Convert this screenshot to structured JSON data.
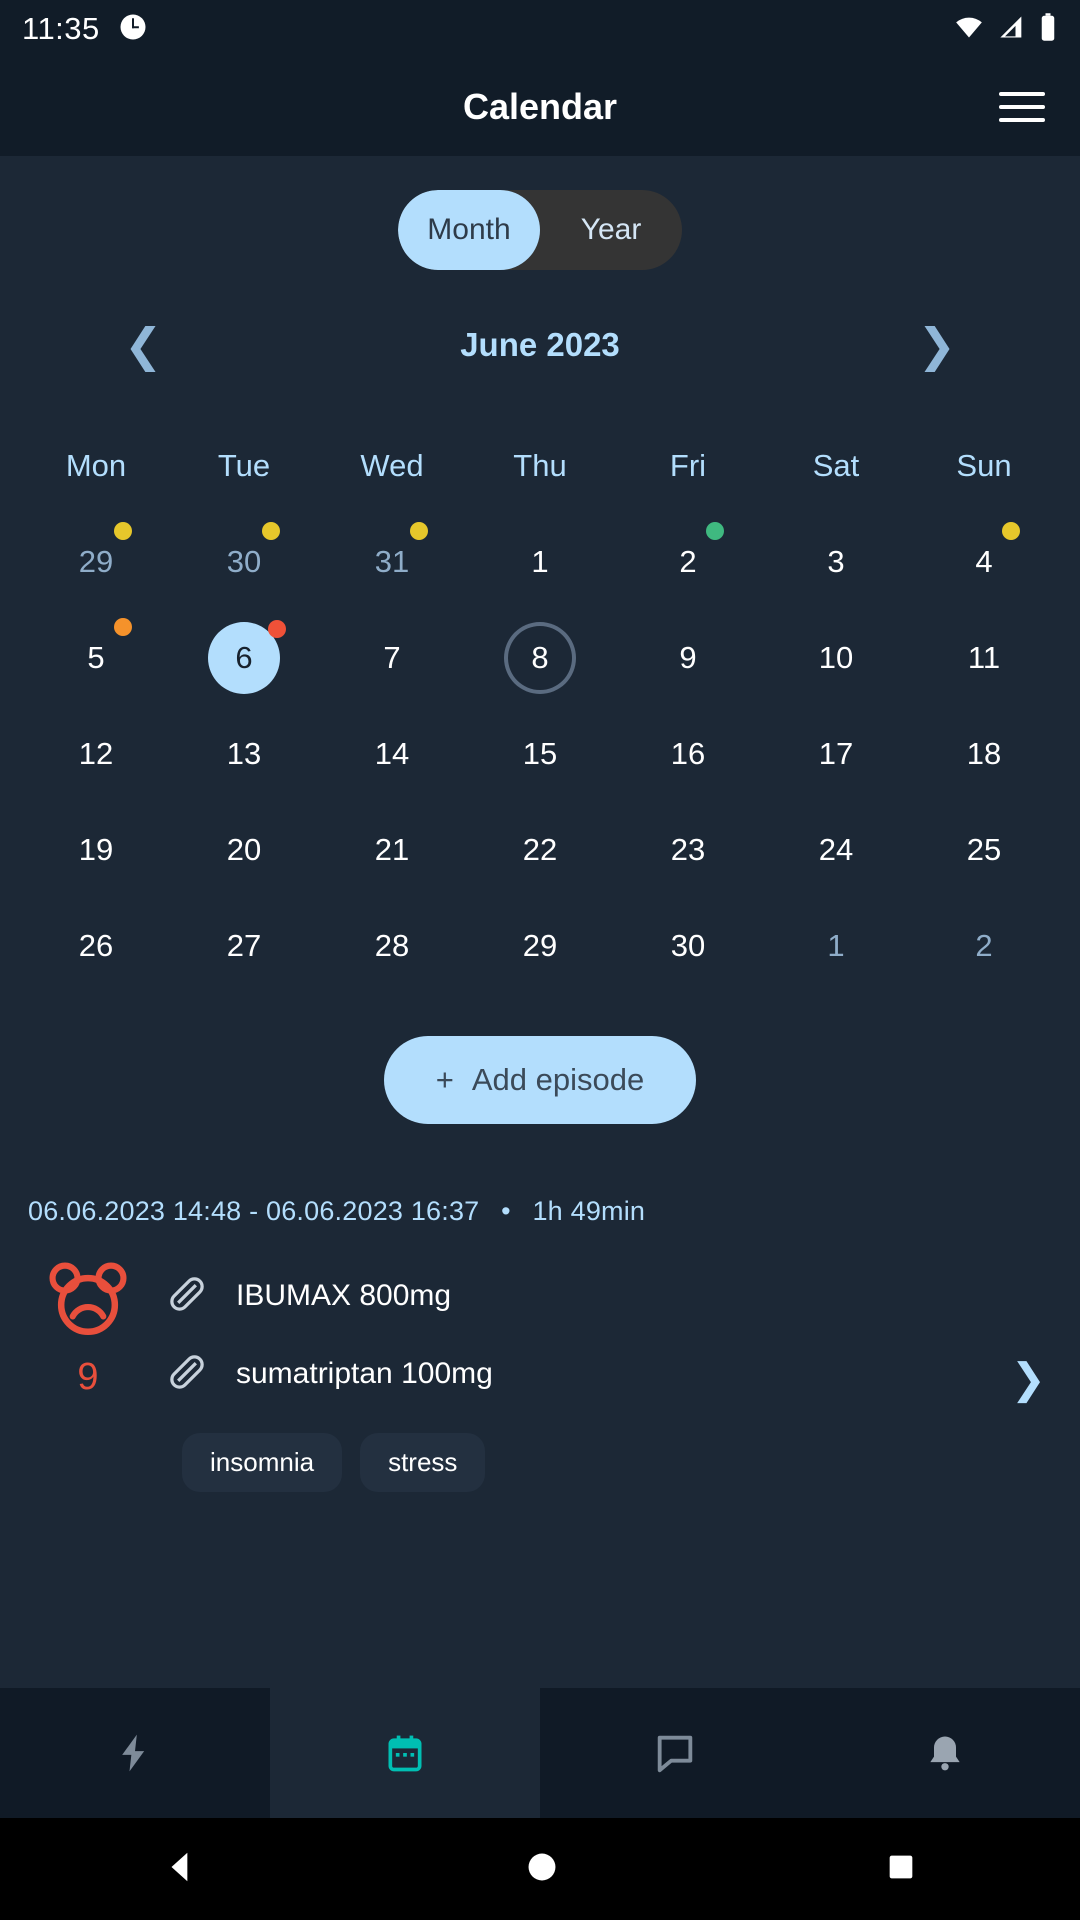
{
  "status_bar": {
    "time": "11:35",
    "left_icon": "clock-icon",
    "icons": [
      "wifi-icon",
      "cellular-signal-icon",
      "battery-icon"
    ]
  },
  "app_bar": {
    "title": "Calendar",
    "menu_icon": "hamburger-menu-icon"
  },
  "view_toggle": {
    "options": [
      {
        "label": "Month",
        "selected": true
      },
      {
        "label": "Year",
        "selected": false
      }
    ],
    "selected_bg": "#B3DEFD",
    "track_bg": "#343434"
  },
  "month_nav": {
    "prev_icon": "chevron-left-icon",
    "next_icon": "chevron-right-icon",
    "label": "June 2023"
  },
  "calendar": {
    "weekdays": [
      "Mon",
      "Tue",
      "Wed",
      "Thu",
      "Fri",
      "Sat",
      "Sun"
    ],
    "weeks": [
      [
        {
          "day": "29",
          "muted": true,
          "dot": "#E6C72B"
        },
        {
          "day": "30",
          "muted": true,
          "dot": "#E6C72B"
        },
        {
          "day": "31",
          "muted": true,
          "dot": "#E6C72B"
        },
        {
          "day": "1",
          "muted": false,
          "dot": null
        },
        {
          "day": "2",
          "muted": false,
          "dot": "#3FB980"
        },
        {
          "day": "3",
          "muted": false,
          "dot": null
        },
        {
          "day": "4",
          "muted": false,
          "dot": "#E6C72B"
        }
      ],
      [
        {
          "day": "5",
          "muted": false,
          "dot": "#F5922B"
        },
        {
          "day": "6",
          "muted": false,
          "dot": "#EF5138",
          "selected": true
        },
        {
          "day": "7",
          "muted": false,
          "dot": null
        },
        {
          "day": "8",
          "muted": false,
          "dot": null,
          "today": true
        },
        {
          "day": "9",
          "muted": false,
          "dot": null
        },
        {
          "day": "10",
          "muted": false,
          "dot": null
        },
        {
          "day": "11",
          "muted": false,
          "dot": null
        }
      ],
      [
        {
          "day": "12",
          "muted": false,
          "dot": null
        },
        {
          "day": "13",
          "muted": false,
          "dot": null
        },
        {
          "day": "14",
          "muted": false,
          "dot": null
        },
        {
          "day": "15",
          "muted": false,
          "dot": null
        },
        {
          "day": "16",
          "muted": false,
          "dot": null
        },
        {
          "day": "17",
          "muted": false,
          "dot": null
        },
        {
          "day": "18",
          "muted": false,
          "dot": null
        }
      ],
      [
        {
          "day": "19",
          "muted": false,
          "dot": null
        },
        {
          "day": "20",
          "muted": false,
          "dot": null
        },
        {
          "day": "21",
          "muted": false,
          "dot": null
        },
        {
          "day": "22",
          "muted": false,
          "dot": null
        },
        {
          "day": "23",
          "muted": false,
          "dot": null
        },
        {
          "day": "24",
          "muted": false,
          "dot": null
        },
        {
          "day": "25",
          "muted": false,
          "dot": null
        }
      ],
      [
        {
          "day": "26",
          "muted": false,
          "dot": null
        },
        {
          "day": "27",
          "muted": false,
          "dot": null
        },
        {
          "day": "28",
          "muted": false,
          "dot": null
        },
        {
          "day": "29",
          "muted": false,
          "dot": null
        },
        {
          "day": "30",
          "muted": false,
          "dot": null
        },
        {
          "day": "1",
          "muted": true,
          "dot": null
        },
        {
          "day": "2",
          "muted": true,
          "dot": null
        }
      ]
    ]
  },
  "add_button": {
    "plus": "+",
    "label": "Add episode"
  },
  "episode": {
    "time_range": "06.06.2023 14:48 - 06.06.2023 16:37",
    "separator": "•",
    "duration": "1h 49min",
    "pain_icon": "sad-bear-face-icon",
    "pain_level": "9",
    "pain_color": "#E84F3C",
    "medications": [
      {
        "icon": "pill-icon",
        "name": "IBUMAX 800mg"
      },
      {
        "icon": "pill-icon",
        "name": "sumatriptan 100mg"
      }
    ],
    "tags": [
      "insomnia",
      "stress"
    ],
    "detail_icon": "chevron-right-icon"
  },
  "bottom_nav": {
    "items": [
      {
        "icon": "lightning-bolt-icon",
        "active": false
      },
      {
        "icon": "calendar-icon",
        "active": true
      },
      {
        "icon": "chat-bubble-icon",
        "active": false
      },
      {
        "icon": "bell-icon",
        "active": false
      }
    ],
    "active_color": "#00BFB3",
    "inactive_color": "#7E8B99"
  },
  "system_nav": {
    "back_icon": "triangle-back-icon",
    "home_icon": "circle-home-icon",
    "recents_icon": "square-recents-icon"
  }
}
